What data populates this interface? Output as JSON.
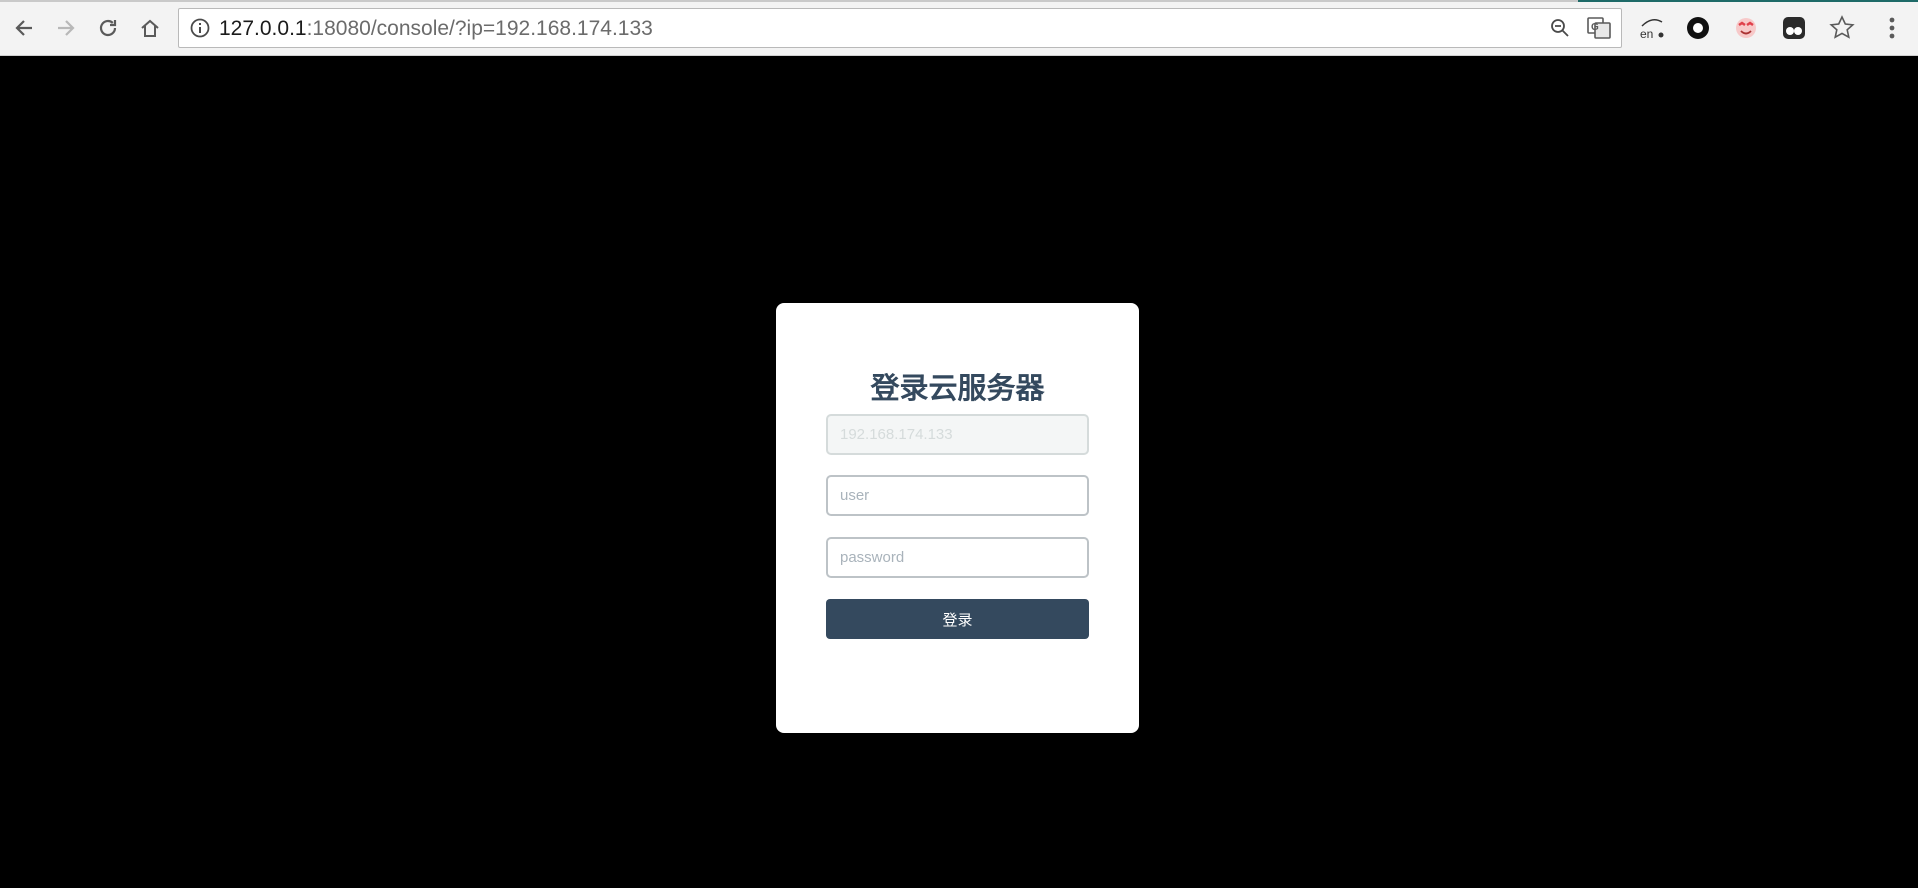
{
  "browser": {
    "url_host": "127.0.0.1",
    "url_rest": ":18080/console/?ip=192.168.174.133",
    "icons": [
      "back-arrow-icon",
      "forward-arrow-icon",
      "reload-icon",
      "home-icon",
      "info-icon",
      "zoom-out-icon",
      "translate-icon",
      "dictionary-extension-icon",
      "record-extension-icon",
      "emoji-extension-icon",
      "tampermonkey-icon",
      "bookmark-star-icon",
      "menu-kebab-icon"
    ],
    "extension_label": "en"
  },
  "login": {
    "title": "登录云服务器",
    "ip_placeholder": "192.168.174.133",
    "user_placeholder": "user",
    "password_placeholder": "password",
    "submit_label": "登录"
  },
  "colors": {
    "page_background": "#000000",
    "card_background": "#ffffff",
    "primary": "#34495e",
    "input_border": "#bdc3c7"
  }
}
